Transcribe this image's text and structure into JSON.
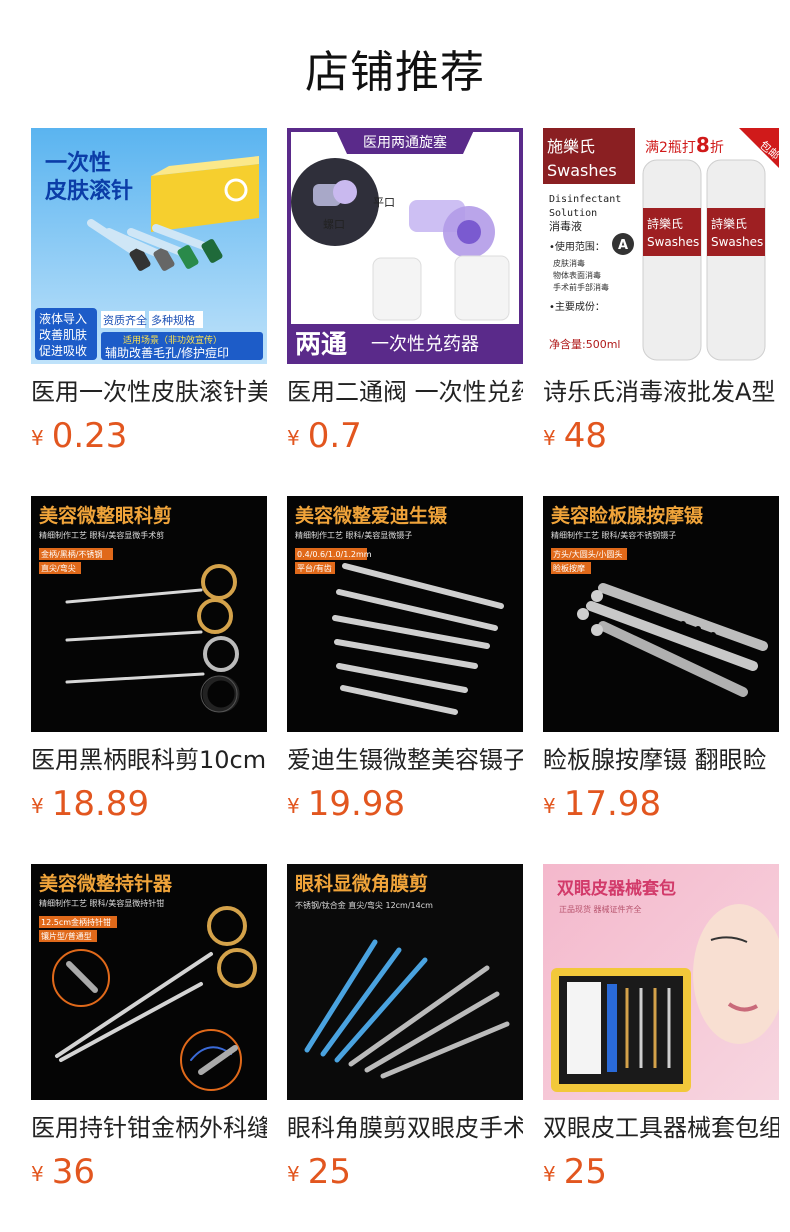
{
  "section_title": "店铺推荐",
  "currency": "¥",
  "products": [
    {
      "name": "医用一次性皮肤滚针美容微针",
      "price": "0.23",
      "img_texts": {
        "t1": "一次性",
        "t2": "皮肤滚针",
        "b1": "资质齐全",
        "b2": "多种规格",
        "s1": "液体导入",
        "s2": "改善肌肤",
        "s3": "促进吸收",
        "u1": "适用场景（非功效宣传）",
        "u2": "辅助改善毛孔/修护痘印"
      }
    },
    {
      "name": "医用二通阀 一次性兑药器",
      "price": "0.7",
      "img_texts": {
        "top": "医用两通旋塞",
        "l1": "螺口",
        "l2": "平口",
        "b1": "两通",
        "b2": "一次性兑药器"
      }
    },
    {
      "name": "诗乐氏消毒液批发A型",
      "price": "48",
      "img_texts": {
        "brand1": "施樂氏",
        "brand2": "Swashes",
        "promo": "满2瓶打",
        "promo_num": "8",
        "promo_unit": "折",
        "tag": "包邮",
        "d1": "Disinfectant",
        "d2": "Solution",
        "d3": "消毒液",
        "u": "•使用范围：",
        "u1": "皮肤消毒",
        "u2": "物体表面消毒",
        "u3": "手术前手部消毒",
        "c": "•主要成份：",
        "net": "净含量:500ml",
        "bottle1": "詩樂氏",
        "bottle2": "Swashes",
        "grade": "A"
      }
    },
    {
      "name": "医用黑柄眼科剪10cm",
      "price": "18.89",
      "img_texts": {
        "title": "美容微整眼科剪",
        "sub": "精细制作工艺 眼科/美容显微手术剪",
        "tag1": "金柄/黑柄/不锈钢",
        "tag2": "直尖/弯尖"
      }
    },
    {
      "name": "爱迪生镊微整美容镊子",
      "price": "19.98",
      "img_texts": {
        "title": "美容微整爱迪生镊",
        "sub": "精细制作工艺 眼科/美容显微镊子",
        "tag1": "0.4/0.6/1.0/1.2mm",
        "tag2": "平台/有齿"
      }
    },
    {
      "name": "睑板腺按摩镊 翻眼睑",
      "price": "17.98",
      "img_texts": {
        "title": "美容睑板腺按摩镊",
        "sub": "精细制作工艺 眼科/美容不锈钢镊子",
        "tag1": "方头/大圆头/小圆头",
        "tag2": "睑板按摩"
      }
    },
    {
      "name": "医用持针钳金柄外科缝合",
      "price": "36",
      "img_texts": {
        "title": "美容微整持针器",
        "sub": "精细制作工艺 眼科/美容显微持针钳",
        "tag1": "12.5cm金柄持针钳",
        "tag2": "镶片型/普通型"
      }
    },
    {
      "name": "眼科角膜剪双眼皮手术",
      "price": "25",
      "img_texts": {
        "title": "眼科显微角膜剪",
        "sub": "不锈钢/钛合金 直尖/弯尖 12cm/14cm"
      }
    },
    {
      "name": "双眼皮工具器械套包组合",
      "price": "25",
      "img_texts": {
        "title": "双眼皮器械套包",
        "sub": "正品现货 器械证件齐全"
      }
    }
  ]
}
